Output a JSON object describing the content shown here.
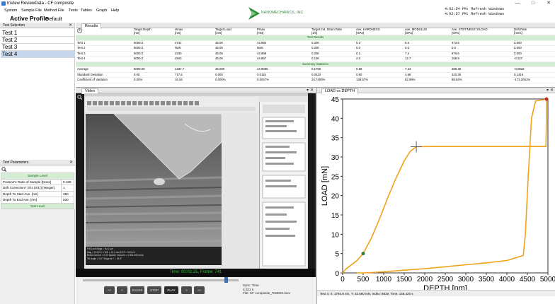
{
  "window": {
    "title": "InView ReviewData - CF composite"
  },
  "menu": [
    "System",
    "Sample File",
    "Method File",
    "Tests",
    "Tables",
    "Graph",
    "Help"
  ],
  "logo": {
    "text": "NANOMECHANICS, INC.",
    "color": "#2e8a37"
  },
  "console": {
    "lines": [
      "4:02:54 PM: Refresh Windows",
      "4:02:57 PM: Refresh Windows"
    ]
  },
  "profile": {
    "label": "Active Profile",
    "value": "Default"
  },
  "test_selection": {
    "title": "Test Selection",
    "items": [
      "Test 1",
      "Test 2",
      "Test 3",
      "Test 4"
    ],
    "selected": 3
  },
  "results": {
    "tab": "Results",
    "columns": [
      "Target Depth\n[nm]",
      "Hmax\n[nm]",
      "Target Load\n[mN]",
      "Pmax\n[mN]",
      "Target Ind. Strain Rate\n[1/s]",
      "Ave. HARDNESS\n[GPa]",
      "Ave. MODULUS\n[GPa]",
      "Ave. STIFFNESS^2/LOAD\n[GPa]",
      "Drift Rate\n[nm/s]"
    ],
    "section1": "Test Results",
    "rows": [
      [
        "Test 1",
        "5000.0",
        "4741",
        "45.00",
        "44.992",
        "0.200",
        "0.3",
        "5.6",
        "473.5",
        "0.000"
      ],
      [
        "Test 2",
        "5000.0",
        "NaN",
        "45.00",
        "NaN",
        "0.200",
        "0.0",
        "0.0",
        "0.0",
        "0.000"
      ],
      [
        "Test 3",
        "5000.0",
        "3330",
        "45.00",
        "44.968",
        "0.200",
        "0.1",
        "7.4",
        "876.6",
        "0.000"
      ],
      [
        "Test 4",
        "5000.0",
        "4943",
        "45.00",
        "44.967",
        "0.100",
        "2.0",
        "12.7",
        "169.9",
        "-0.327"
      ]
    ],
    "section2": "Summary Statistics",
    "stats": [
      [
        "Average",
        "5000.00",
        "4337.7",
        "45.000",
        "44.9695",
        "0.1750",
        "0.58",
        "7.43",
        "388.48",
        "-0.0818"
      ],
      [
        "Standard Deviation",
        "0.00",
        "717.6",
        "0.000",
        "0.0116",
        "0.0433",
        "0.80",
        "4.68",
        "343.36",
        "0.1416"
      ],
      [
        "Coefficient of Variation",
        "0.00%",
        "16.54",
        "0.000%",
        "0.0047%",
        "24.7400%",
        "138.57%",
        "62.99%",
        "88.84%",
        "-173.2051%"
      ]
    ]
  },
  "parameters": {
    "title": "Test Parameters",
    "section1": "Sample Level",
    "rows": [
      [
        "Poisson's Ratio of Sample [None]",
        "0.188"
      ],
      [
        "Drift Correction? (0/1 (0/1)) [Integer]",
        "1"
      ],
      [
        "Depth To Start Ave. [nm]",
        "350"
      ],
      [
        "Depth To End Ave. [nm]",
        "500"
      ]
    ],
    "section2": "Test Level"
  },
  "video": {
    "tab": "Video",
    "status": "Time: 00:02.25, Frame: 741",
    "buttons": [
      "<<",
      "<",
      "PAUSE",
      "STOP",
      "PLAY",
      ">",
      ">>"
    ],
    "sync_lines": [
      "Sync: Time",
      "0.321 s",
      "File: CF composite_Test004.mov"
    ],
    "sem_info": [
      "FIB Lock Mags = No   1 µm",
      "Mag = 10.00 K X   WD = 10.2 mm   EHT = 3.00 kV",
      "Beam Current = 0.00   System Vacuum = 2.30e-006 mbar",
      "Tilt Angle = 0.0°   Stage at Y = 15.8°"
    ],
    "colors": {
      "bg": "#1a1a1a",
      "status": "#2ec13a"
    }
  },
  "plot": {
    "tab": "LOAD vs DEPTH",
    "status": "Test 4: X: 1794.8 nm, Y: 32.660 mN, Index: 8819, Time: 148.420 s",
    "colors": {
      "curve": "#f0a21a",
      "start": "#2e7d32",
      "end": "#c62828"
    }
  },
  "chart_data": {
    "type": "line",
    "xlabel": "DEPTH [nm]",
    "ylabel": "LOAD [mN]",
    "xlim": [
      0,
      5000
    ],
    "ylim": [
      0,
      45
    ],
    "xticks": [
      0,
      500,
      1000,
      1500,
      2000,
      2500,
      3000,
      3500,
      4000,
      4500,
      5000
    ],
    "yticks": [
      0,
      5,
      10,
      15,
      20,
      25,
      30,
      35,
      40,
      45
    ],
    "series": [
      {
        "x": [
          0,
          80,
          200,
          350,
          500,
          700,
          900,
          1100,
          1300,
          1500,
          1650,
          1794.8,
          2200,
          2800,
          3400,
          4000,
          4600,
          4950,
          4960,
          4965,
          4950,
          4700,
          4600,
          4520,
          4450,
          4400,
          4000,
          3500,
          3000,
          2500,
          2000,
          1500,
          1000,
          700,
          500,
          350
        ],
        "y": [
          0,
          1.0,
          2.0,
          3.2,
          5.0,
          9.0,
          14.0,
          19.5,
          24.5,
          29.0,
          31.5,
          32.66,
          32.7,
          32.7,
          32.7,
          32.7,
          32.7,
          32.7,
          38.0,
          44.97,
          44.9,
          44.5,
          40.0,
          25.0,
          10.0,
          4.5,
          3.2,
          2.6,
          2.1,
          1.6,
          1.1,
          0.7,
          0.3,
          0.1,
          0.0,
          0.0
        ]
      }
    ],
    "markers": [
      {
        "label": "start",
        "x": 500,
        "y": 5.0
      },
      {
        "label": "cursor",
        "x": 1794.8,
        "y": 32.66
      },
      {
        "label": "end",
        "x": 4965,
        "y": 44.97
      }
    ]
  }
}
